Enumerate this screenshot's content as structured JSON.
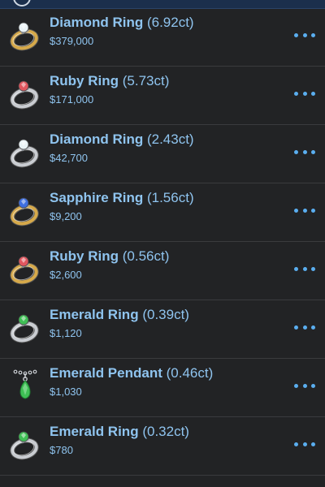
{
  "items": [
    {
      "name": "Diamond Ring",
      "carat": "(6.92ct)",
      "price": "$379,000",
      "band": "#d6a94a",
      "gem": "#e9f3f6",
      "icon": "diamond-gold-ring-icon"
    },
    {
      "name": "Ruby Ring",
      "carat": "(5.73ct)",
      "price": "$171,000",
      "band": "#c9ccd1",
      "gem": "#e0565e",
      "icon": "ruby-silver-ring-icon"
    },
    {
      "name": "Diamond Ring",
      "carat": "(2.43ct)",
      "price": "$42,700",
      "band": "#c9ccd1",
      "gem": "#e9f3f6",
      "icon": "diamond-silver-ring-icon"
    },
    {
      "name": "Sapphire Ring",
      "carat": "(1.56ct)",
      "price": "$9,200",
      "band": "#d6a94a",
      "gem": "#3f6fe0",
      "icon": "sapphire-gold-ring-icon"
    },
    {
      "name": "Ruby Ring",
      "carat": "(0.56ct)",
      "price": "$2,600",
      "band": "#d6a94a",
      "gem": "#e0565e",
      "icon": "ruby-gold-ring-icon"
    },
    {
      "name": "Emerald Ring",
      "carat": "(0.39ct)",
      "price": "$1,120",
      "band": "#c9ccd1",
      "gem": "#3fbf55",
      "icon": "emerald-silver-ring-icon"
    },
    {
      "name": "Emerald Pendant",
      "carat": "(0.46ct)",
      "price": "$1,030",
      "band": "#c9ccd1",
      "gem": "#3fbf55",
      "icon": "emerald-pendant-icon"
    },
    {
      "name": "Emerald Ring",
      "carat": "(0.32ct)",
      "price": "$780",
      "band": "#c9ccd1",
      "gem": "#3fbf55",
      "icon": "emerald-silver-ring-icon"
    }
  ],
  "colors": {
    "background": "#222325",
    "header": "#1b2f4c",
    "accent_text": "#8fc4ef",
    "more_dots": "#5aaef0",
    "divider": "#3a3b3e"
  }
}
